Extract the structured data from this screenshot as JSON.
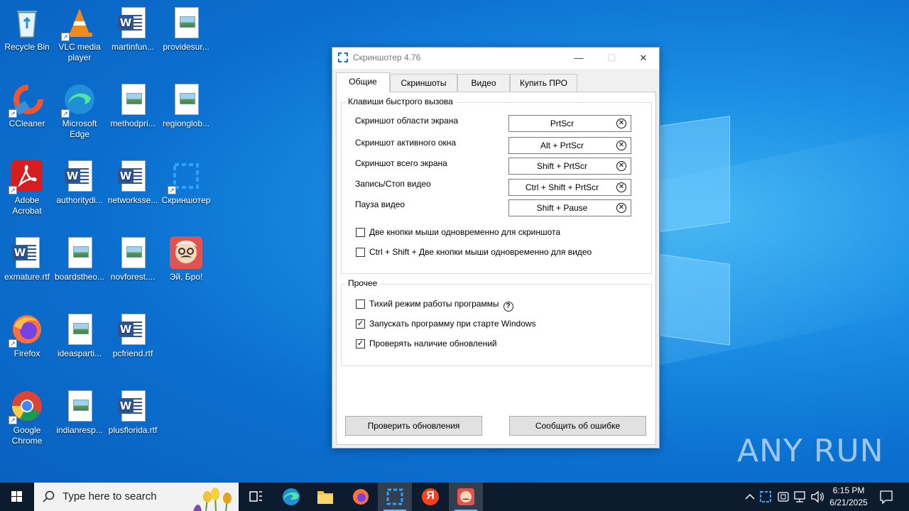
{
  "desktop": {
    "icons": [
      {
        "name": "recycle-bin",
        "label": "Recycle Bin"
      },
      {
        "name": "vlc",
        "label": "VLC media player"
      },
      {
        "name": "martinfun",
        "label": "martinfun..."
      },
      {
        "name": "providesur",
        "label": "providesur..."
      },
      {
        "name": "ccleaner",
        "label": "CCleaner"
      },
      {
        "name": "edge",
        "label": "Microsoft Edge"
      },
      {
        "name": "methodpri",
        "label": "methodpri..."
      },
      {
        "name": "regionglob",
        "label": "regionglob..."
      },
      {
        "name": "acrobat",
        "label": "Adobe Acrobat"
      },
      {
        "name": "authoritydi",
        "label": "authoritydi..."
      },
      {
        "name": "networksse",
        "label": "networksse..."
      },
      {
        "name": "screenshoter",
        "label": "Скриншотер"
      },
      {
        "name": "exmature",
        "label": "exmature.rtf"
      },
      {
        "name": "boardstheo",
        "label": "boardstheo..."
      },
      {
        "name": "novforest",
        "label": "novforest...."
      },
      {
        "name": "ei-bro",
        "label": "Эй, Бро!"
      },
      {
        "name": "firefox",
        "label": "Firefox"
      },
      {
        "name": "ideasparti",
        "label": "ideasparti..."
      },
      {
        "name": "pcfriend",
        "label": "pcfriend.rtf"
      },
      {
        "name": "chrome",
        "label": "Google Chrome"
      },
      {
        "name": "indianresp",
        "label": "indianresp..."
      },
      {
        "name": "plusflorida",
        "label": "plusflorida.rtf"
      }
    ]
  },
  "dialog": {
    "title": "Скриншотер 4.76",
    "tabs": [
      "Общие",
      "Скриншоты",
      "Видео",
      "Купить ПРО"
    ],
    "hotkeys_legend": "Клавиши быстрого вызова",
    "hotkeys": [
      {
        "label": "Скриншот области экрана",
        "value": "PrtScr"
      },
      {
        "label": "Скриншот активного окна",
        "value": "Alt + PrtScr"
      },
      {
        "label": "Скриншот всего экрана",
        "value": "Shift + PrtScr"
      },
      {
        "label": "Запись/Стоп видео",
        "value": "Ctrl + Shift + PrtScr"
      },
      {
        "label": "Пауза видео",
        "value": "Shift + Pause"
      }
    ],
    "mouse_options": [
      {
        "label": "Две кнопки мыши одновременно для скриншота",
        "checked": false
      },
      {
        "label": "Ctrl + Shift + Две кнопки мыши одновременно для видео",
        "checked": false
      }
    ],
    "other_legend": "Прочее",
    "other_options": [
      {
        "label": "Тихий режим работы программы",
        "checked": false,
        "help": "?"
      },
      {
        "label": "Запускать программу при старте Windows",
        "checked": true
      },
      {
        "label": "Проверять наличие обновлений",
        "checked": true
      }
    ],
    "check_updates_button": "Проверить обновления",
    "report_bug_button": "Сообщить об ошибке",
    "clear_glyph": "✕",
    "check_glyph": "✓"
  },
  "taskbar": {
    "search_placeholder": "Type here to search",
    "time": "6:15 PM",
    "date": "6/21/2025",
    "yandex_letter": "Я"
  },
  "watermark": "ANY RUN"
}
